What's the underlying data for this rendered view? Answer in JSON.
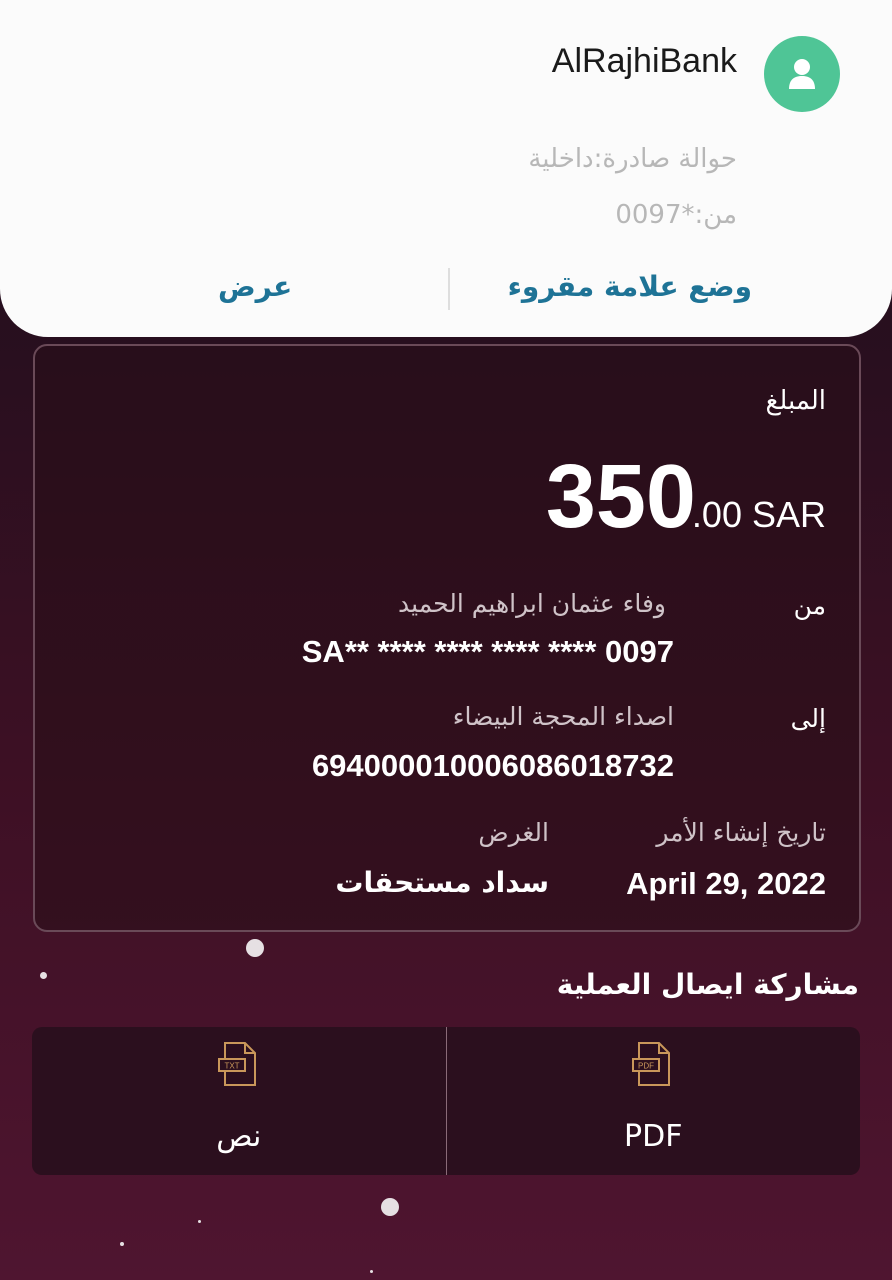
{
  "notification": {
    "app_name": "AlRajhiBank",
    "line1": "حوالة صادرة:داخلية",
    "line2": "من:*0097",
    "mark_read": "وضع علامة مقروء",
    "view": "عرض"
  },
  "transfer": {
    "amount_label": "المبلغ",
    "amount_integer": "350",
    "amount_decimal": ".00 SAR",
    "from_label": "من",
    "from_name": "وفاء عثمان ابراهيم الحميد",
    "from_account": "SA** **** **** **** **** 0097",
    "to_label": "إلى",
    "to_name": "اصداء المحجة البيضاء",
    "to_account": "694000010006086018732",
    "date_label": "تاريخ إنشاء الأمر",
    "date_value": "April 29, 2022",
    "purpose_label": "الغرض",
    "purpose_value": "سداد مستحقات"
  },
  "share": {
    "title": "مشاركة ايصال العملية",
    "options": [
      {
        "label": "نص",
        "icon": "txt-file-icon",
        "badge": "TXT"
      },
      {
        "label": "PDF",
        "icon": "pdf-file-icon",
        "badge": "PDF"
      }
    ]
  },
  "colors": {
    "accent_link": "#1e7396",
    "avatar": "#4fc596",
    "icon_gold": "#c9975a"
  }
}
